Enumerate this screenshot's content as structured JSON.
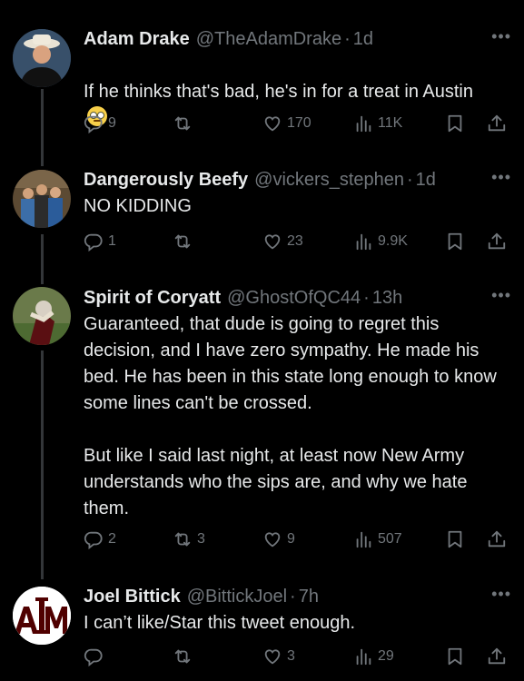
{
  "tweets": [
    {
      "name": "Adam Drake",
      "handle": "@TheAdamDrake",
      "time": "1d",
      "text": "If he thinks that's bad, he's in for a treat in Austin",
      "emoji": "face-with-rolling-eyes",
      "replies": "9",
      "retweets": "",
      "likes": "170",
      "views": "11K"
    },
    {
      "name": "Dangerously Beefy",
      "handle": "@vickers_stephen",
      "time": "1d",
      "text": "NO KIDDING",
      "replies": "1",
      "retweets": "",
      "likes": "23",
      "views": "9.9K"
    },
    {
      "name": "Spirit of Coryatt",
      "handle": "@GhostOfQC44",
      "time": "13h",
      "text": "Guaranteed, that dude is going to regret this decision, and I have zero sympathy. He made his bed. He has been in this state long enough to know some lines can't be crossed.\n\nBut like I said last night, at least now New Army understands who the sips are, and why we hate them.",
      "replies": "2",
      "retweets": "3",
      "likes": "9",
      "views": "507"
    },
    {
      "name": "Joel Bittick",
      "handle": "@BittickJoel",
      "time": "7h",
      "text": "I can’t like/Star this tweet enough.",
      "replies": "",
      "retweets": "",
      "likes": "3",
      "views": "29"
    }
  ],
  "icons": {
    "reply": "reply-icon",
    "retweet": "retweet-icon",
    "like": "heart-icon",
    "views": "views-icon",
    "bookmark": "bookmark-icon",
    "share": "share-icon",
    "more": "more-icon"
  },
  "colors": {
    "background": "#000000",
    "text": "#e7e9ea",
    "secondary": "#71767b",
    "thread_line": "#333639",
    "aggie_maroon": "#500000"
  }
}
